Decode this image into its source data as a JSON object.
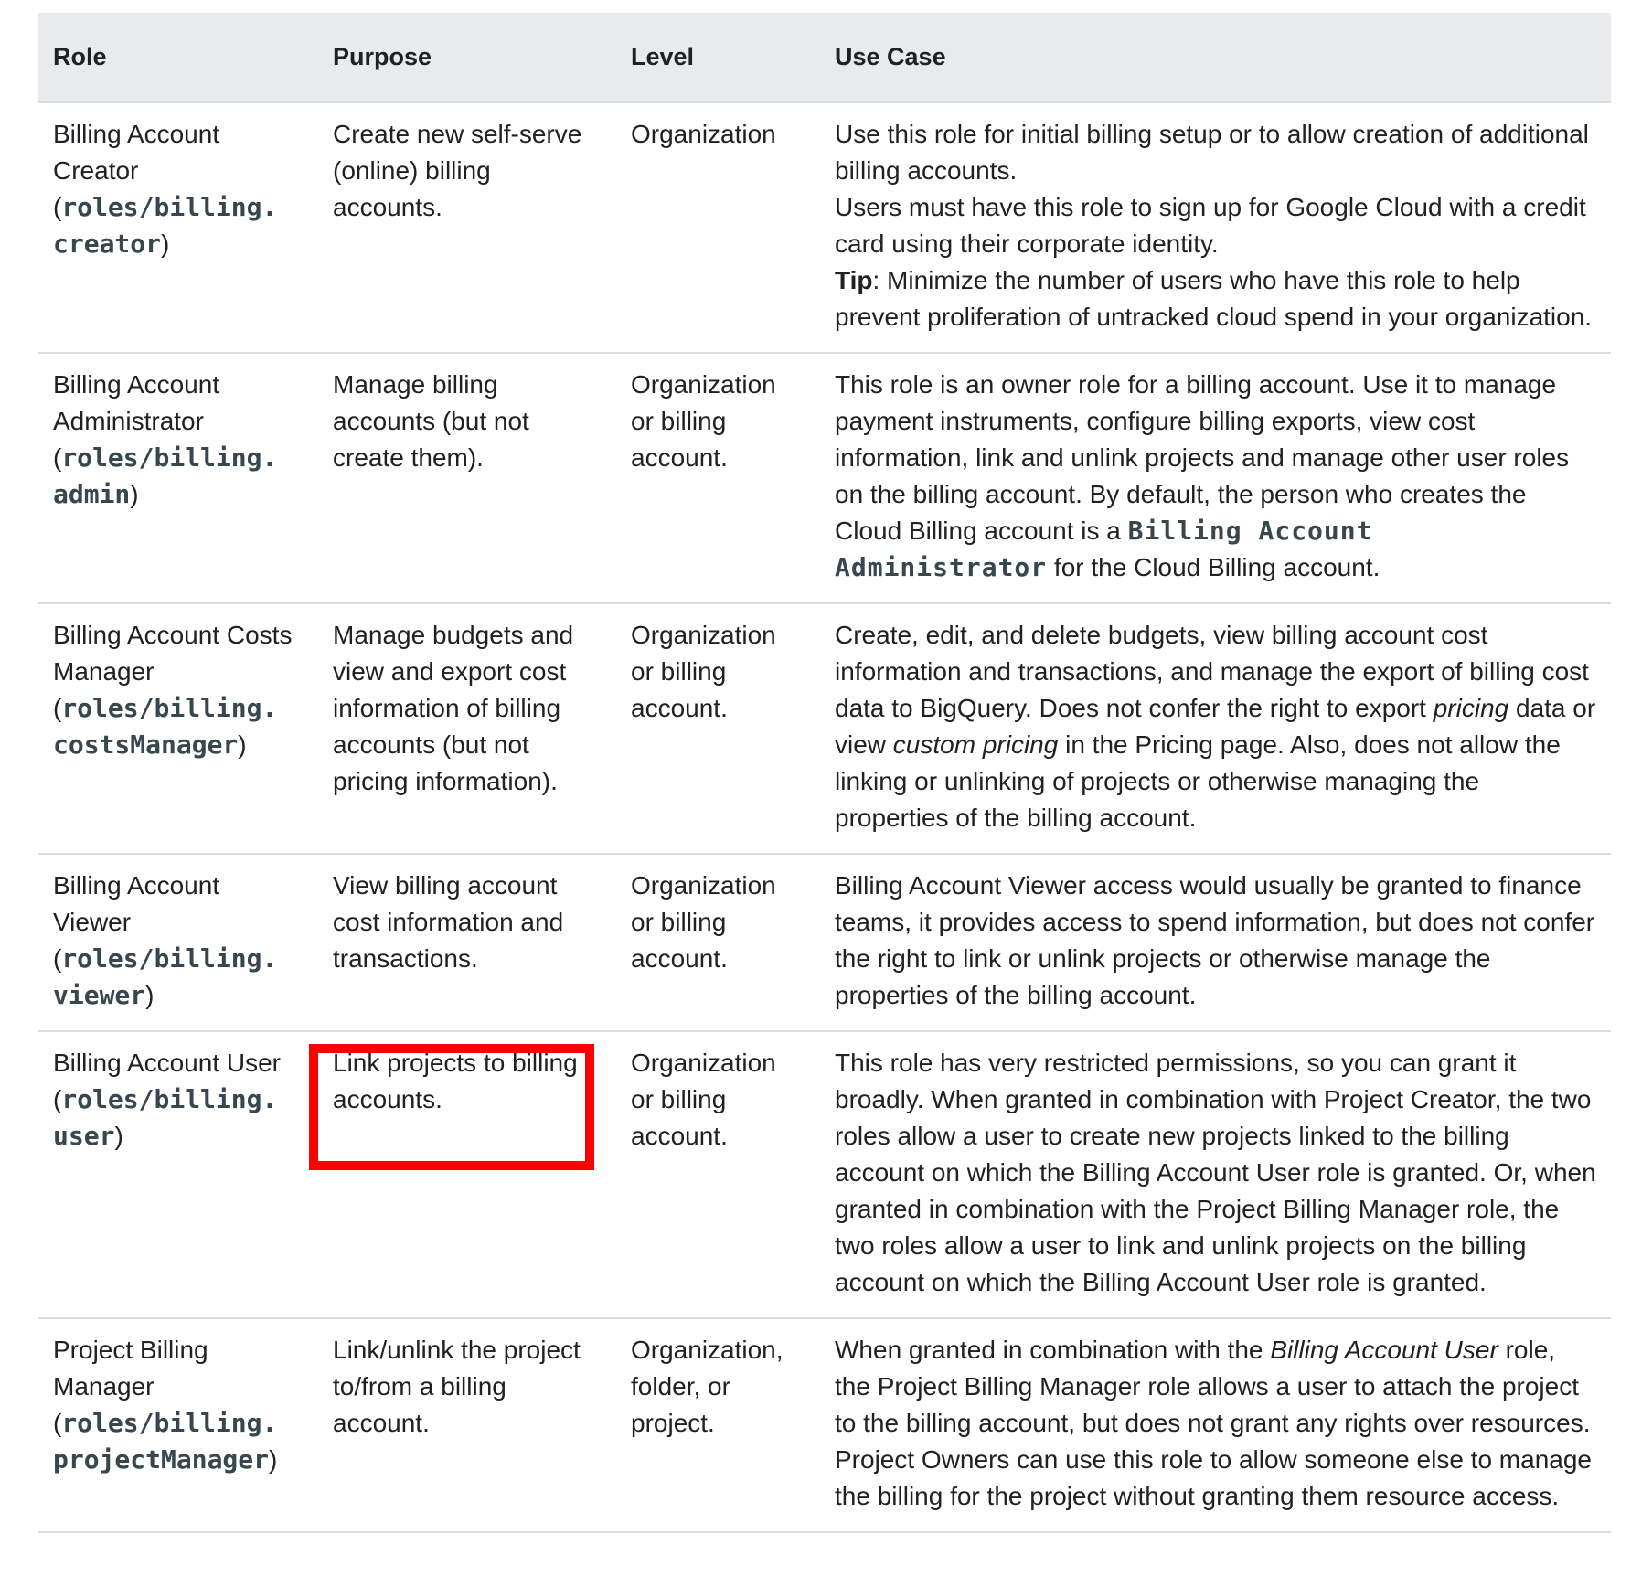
{
  "table": {
    "headers": {
      "role": "Role",
      "purpose": "Purpose",
      "level": "Level",
      "use_case": "Use Case"
    },
    "rows": [
      {
        "role_name": "Billing Account Creator",
        "role_id_open": "(",
        "role_id_a": "roles/billing.",
        "role_id_b": "creator",
        "role_id_close": ")",
        "purpose": "Create new self-serve (online) billing accounts.",
        "level": "Organization",
        "use_case_1": "Use this role for initial billing setup or to allow creation of additional billing accounts.",
        "use_case_2": "Users must have this role to sign up for Google Cloud with a credit card using their corporate identity.",
        "tip_label": "Tip",
        "tip_text": ": Minimize the number of users who have this role to help prevent proliferation of untracked cloud spend in your organization."
      },
      {
        "role_name": "Billing Account Administrator",
        "role_id_open": "(",
        "role_id_a": "roles/billing.",
        "role_id_b": "admin",
        "role_id_close": ")",
        "purpose": "Manage billing accounts (but not create them).",
        "level": "Organization or billing account.",
        "use_case_1": "This role is an owner role for a billing account. Use it to manage payment instruments, configure billing exports, view cost information, link and unlink projects and manage other user roles on the billing account. By default, the person who creates the Cloud Billing account is a ",
        "use_case_code": "Billing Account Administrator",
        "use_case_2": " for the Cloud Billing account."
      },
      {
        "role_name": "Billing Account Costs Manager",
        "role_id_open": "(",
        "role_id_a": "roles/billing.",
        "role_id_b": "costsManager",
        "role_id_close": ")",
        "purpose": "Manage budgets and view and export cost information of billing accounts (but not pricing information).",
        "level": "Organization or billing account.",
        "use_case_1": "Create, edit, and delete budgets, view billing account cost information and transactions, and manage the export of billing cost data to BigQuery. Does not confer the right to export ",
        "use_case_em_1": "pricing",
        "use_case_2": " data or view ",
        "use_case_em_2": "custom pricing",
        "use_case_3": " in the Pricing page. Also, does not allow the linking or unlinking of projects or otherwise managing the properties of the billing account."
      },
      {
        "role_name": "Billing Account Viewer",
        "role_id_open": "(",
        "role_id_a": "roles/billing.",
        "role_id_b": "viewer",
        "role_id_close": ")",
        "purpose": "View billing account cost information and transactions.",
        "level": "Organization or billing account.",
        "use_case_1": "Billing Account Viewer access would usually be granted to finance teams, it provides access to spend information, but does not confer the right to link or unlink projects or otherwise manage the properties of the billing account."
      },
      {
        "role_name": "Billing Account User",
        "role_id_open": "(",
        "role_id_a": "roles/billing.",
        "role_id_b": "user",
        "role_id_close": ")",
        "purpose": "Link projects to billing accounts.",
        "level": "Organization or billing account.",
        "use_case_1": "This role has very restricted permissions, so you can grant it broadly. When granted in combination with Project Creator, the two roles allow a user to create new projects linked to the billing account on which the Billing Account User role is granted. Or, when granted in combination with the Project Billing Manager role, the two roles allow a user to link and unlink projects on the billing account on which the Billing Account User role is granted."
      },
      {
        "role_name": "Project Billing Manager",
        "role_id_open": "(",
        "role_id_a": "roles/billing.",
        "role_id_b": "projectManager",
        "role_id_close": ")",
        "purpose": "Link/unlink the project to/from a billing account.",
        "level": "Organization, folder, or project.",
        "use_case_1": "When granted in combination with the ",
        "use_case_em_1": "Billing Account User",
        "use_case_2": " role, the Project Billing Manager role allows a user to attach the project to the billing account, but does not grant any rights over resources. Project Owners can use this role to allow someone else to manage the billing for the project without granting them resource access."
      }
    ]
  },
  "highlight": {
    "color": "#ff0000",
    "target": "Link projects to billing accounts."
  }
}
